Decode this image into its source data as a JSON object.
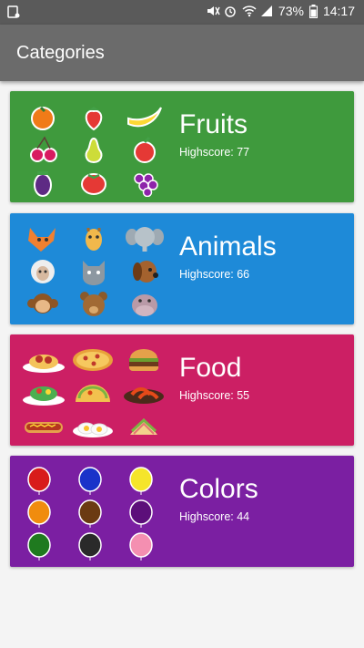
{
  "status_bar": {
    "battery": "73%",
    "time": "14:17",
    "icons": [
      "sim-icon",
      "mute-icon",
      "alarm-icon",
      "wifi-icon",
      "signal-icon",
      "battery-icon"
    ]
  },
  "app_bar": {
    "title": "Categories"
  },
  "colors": {
    "fruits": "#3f9a3d",
    "animals": "#1e8ad8",
    "food": "#cc1f64",
    "colors": "#7b1fa2"
  },
  "categories": [
    {
      "name": "Fruits",
      "highscore_label": "Highscore: 77",
      "icons": [
        "orange-icon",
        "strawberry-icon",
        "banana-icon",
        "cherry-icon",
        "pear-icon",
        "apple-icon",
        "eggplant-icon",
        "tomato-icon",
        "grapes-icon"
      ]
    },
    {
      "name": "Animals",
      "highscore_label": "Highscore: 66",
      "icons": [
        "fox-icon",
        "giraffe-icon",
        "elephant-icon",
        "sheep-icon",
        "cat-icon",
        "dog-icon",
        "monkey-icon",
        "bear-icon",
        "hippo-icon"
      ]
    },
    {
      "name": "Food",
      "highscore_label": "Highscore: 55",
      "icons": [
        "spaghetti-icon",
        "pizza-icon",
        "burger-icon",
        "salad-icon",
        "taco-icon",
        "shrimp-icon",
        "hotdog-icon",
        "eggs-icon",
        "sandwich-icon"
      ]
    },
    {
      "name": "Colors",
      "highscore_label": "Highscore: 44",
      "icons": [
        "red-balloon-icon",
        "blue-balloon-icon",
        "yellow-balloon-icon",
        "orange-balloon-icon",
        "brown-balloon-icon",
        "purple-balloon-icon",
        "green-balloon-icon",
        "black-balloon-icon",
        "pink-balloon-icon"
      ]
    }
  ]
}
